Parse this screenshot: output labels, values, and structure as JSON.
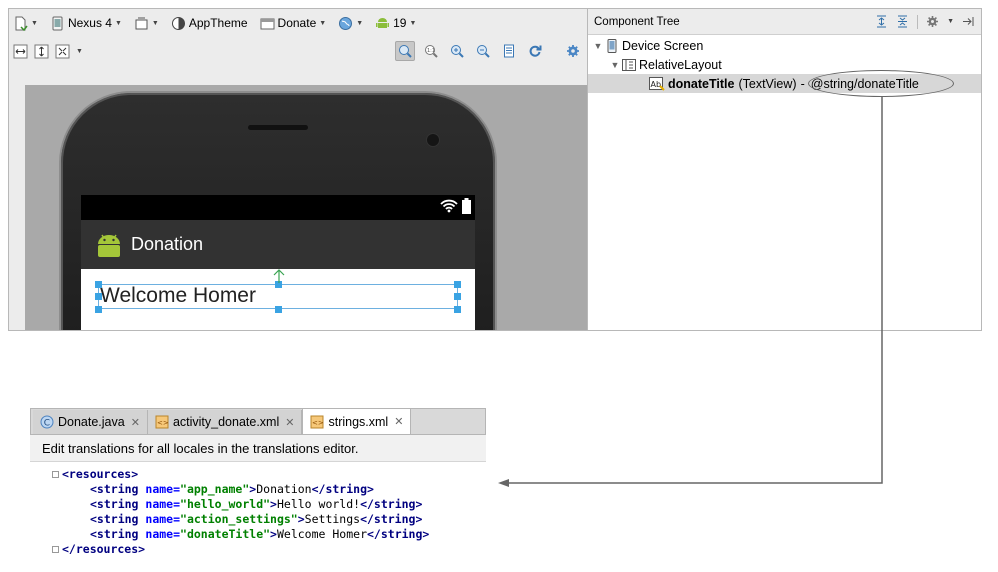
{
  "designer": {
    "toolbar1": {
      "device": "Nexus 4",
      "theme": "AppTheme",
      "activity": "Donate",
      "api": "19"
    },
    "app_title": "Donation",
    "welcome_text": "Welcome Homer"
  },
  "component_tree": {
    "title": "Component Tree",
    "nodes": {
      "device_screen": "Device Screen",
      "relative_layout": "RelativeLayout",
      "donate_title_name": "donateTitle",
      "donate_title_type": "(TextView)",
      "donate_title_sep": "-",
      "donate_title_value": "@string/donateTitle"
    }
  },
  "editor": {
    "tabs": [
      {
        "label": "Donate.java"
      },
      {
        "label": "activity_donate.xml"
      },
      {
        "label": "strings.xml"
      }
    ],
    "banner": "Edit translations for all locales in the translations editor.",
    "code": {
      "open_tag": "<resources>",
      "close_tag": "</resources>",
      "strings": [
        {
          "name": "\"app_name\"",
          "value": "Donation"
        },
        {
          "name": "\"hello_world\"",
          "value": "Hello world!"
        },
        {
          "name": "\"action_settings\"",
          "value": "Settings"
        },
        {
          "name": "\"donateTitle\"",
          "value": "Welcome Homer"
        }
      ],
      "string_open": "<string",
      "string_close": "</string>",
      "attr_name": "name=",
      "gt": ">"
    }
  },
  "colors": {
    "accent": "#3aa3e3",
    "actionbar": "#323232",
    "selection": "#d7d7d7",
    "arrow": "#666666"
  }
}
